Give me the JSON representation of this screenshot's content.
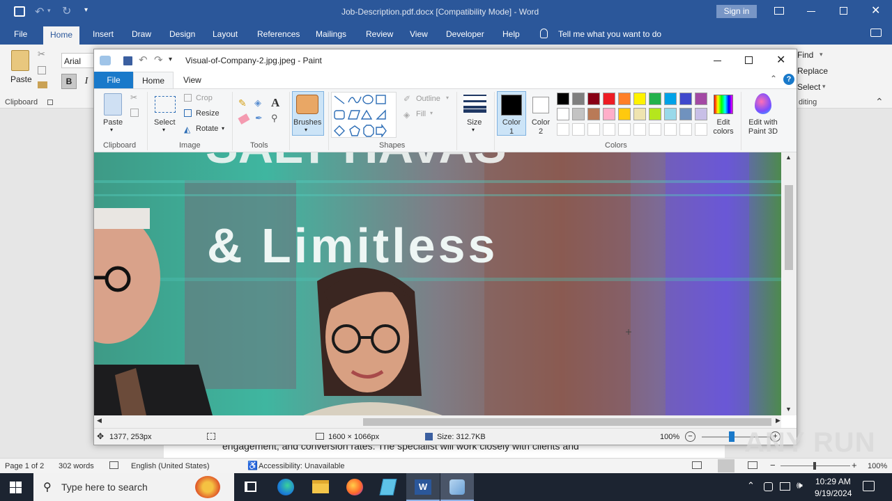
{
  "word": {
    "title": "Job-Description.pdf.docx [Compatibility Mode]  -  Word",
    "sign_in": "Sign in",
    "tabs": [
      "File",
      "Home",
      "Insert",
      "Draw",
      "Design",
      "Layout",
      "References",
      "Mailings",
      "Review",
      "View",
      "Developer",
      "Help"
    ],
    "tell_me": "Tell me what you want to do",
    "font_name": "Arial",
    "paste_label": "Paste",
    "clipboard_label": "Clipboard",
    "editing": {
      "find": "Find",
      "replace": "Replace",
      "select": "Select",
      "editing_label": "diting"
    },
    "doc_text": "engagement, and conversion rates. The specialist will work closely with clients and",
    "status": {
      "page": "Page 1 of 2",
      "words": "302 words",
      "language": "English (United States)",
      "accessibility": "Accessibility: Unavailable",
      "zoom": "100%"
    }
  },
  "paint": {
    "title": "Visual-of-Company-2.jpg.jpeg - Paint",
    "tabs": {
      "file": "File",
      "home": "Home",
      "view": "View"
    },
    "clipboard": {
      "paste": "Paste",
      "label": "Clipboard"
    },
    "image": {
      "select": "Select",
      "crop": "Crop",
      "resize": "Resize",
      "rotate": "Rotate",
      "label": "Image"
    },
    "tools": {
      "label": "Tools"
    },
    "brushes": "Brushes",
    "shapes": {
      "outline": "Outline",
      "fill": "Fill",
      "label": "Shapes"
    },
    "size": "Size",
    "color1": "Color 1",
    "color2": "Color 2",
    "colors_label": "Colors",
    "edit_colors": "Edit colors",
    "edit_paint3d": "Edit with Paint 3D",
    "palette_row1": [
      "#000000",
      "#7f7f7f",
      "#880015",
      "#ed1c24",
      "#ff7f27",
      "#fff200",
      "#22b14c",
      "#00a2e8",
      "#3f48cc",
      "#a349a4"
    ],
    "palette_row2": [
      "#ffffff",
      "#c3c3c3",
      "#b97a57",
      "#ffaec9",
      "#ffc90e",
      "#efe4b0",
      "#b5e61d",
      "#99d9ea",
      "#7092be",
      "#c8bfe7"
    ],
    "canvas_text": "&  Limitless",
    "canvas_left_text": "e",
    "status": {
      "cursor": "1377, 253px",
      "dimensions": "1600 × 1066px",
      "size": "Size: 312.7KB",
      "zoom": "100%"
    }
  },
  "taskbar": {
    "search_placeholder": "Type here to search",
    "time": "10:29 AM",
    "date": "9/19/2024"
  },
  "watermark": "ANY RUN"
}
